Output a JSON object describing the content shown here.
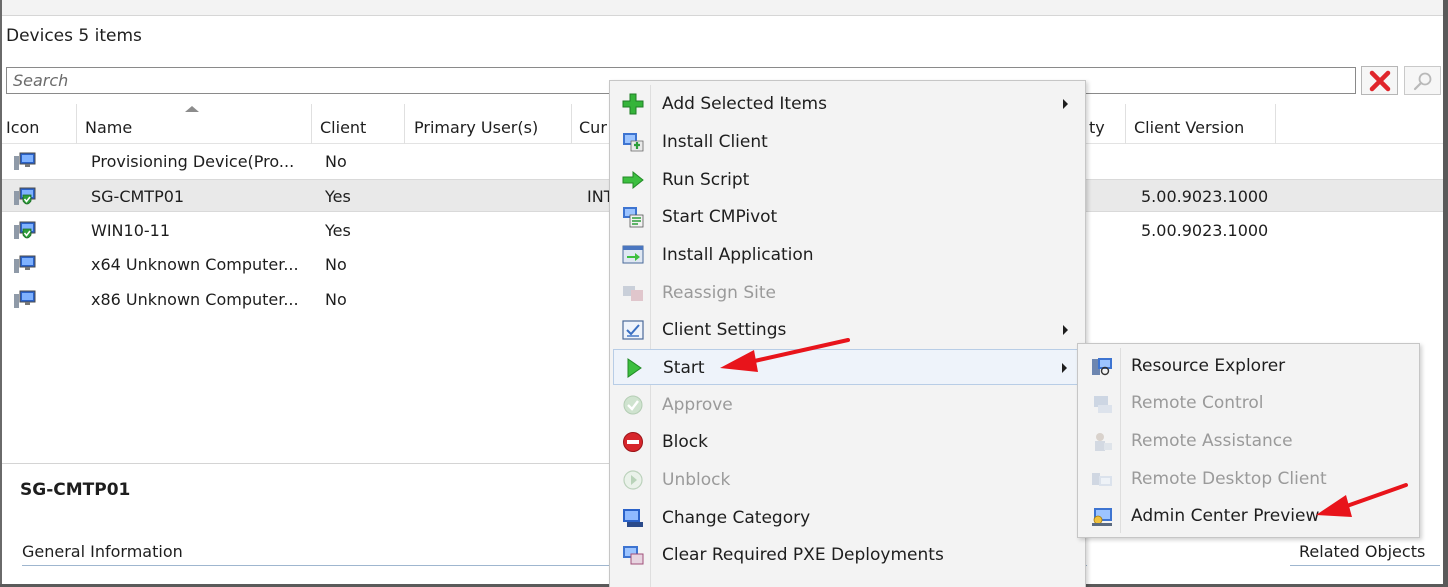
{
  "header": {
    "title": "Devices",
    "count": "5 items"
  },
  "search": {
    "placeholder": "Search"
  },
  "columns": [
    "Icon",
    "Name",
    "Client",
    "Primary User(s)",
    "Cur",
    "ty",
    "Client Version"
  ],
  "rows": [
    {
      "name": "Provisioning Device(Pro...",
      "client": "No",
      "currentuser": "",
      "version": "",
      "status": "plain"
    },
    {
      "name": "SG-CMTP01",
      "client": "Yes",
      "currentuser": "INT",
      "version": "5.00.9023.1000",
      "status": "managed",
      "selected": true
    },
    {
      "name": "WIN10-11",
      "client": "Yes",
      "currentuser": "",
      "version": "5.00.9023.1000",
      "status": "managed"
    },
    {
      "name": "x64 Unknown Computer...",
      "client": "No",
      "currentuser": "",
      "version": "",
      "status": "plain"
    },
    {
      "name": "x86 Unknown Computer...",
      "client": "No",
      "currentuser": "",
      "version": "",
      "status": "plain"
    }
  ],
  "details": {
    "selected_name": "SG-CMTP01",
    "general_info": "General Information",
    "related_objects": "Related Objects"
  },
  "context_menu": {
    "items": [
      {
        "label": "Add Selected Items",
        "icon": "add-icon",
        "submenu": true,
        "disabled": false
      },
      {
        "label": "Install Client",
        "icon": "install-client-icon",
        "submenu": false,
        "disabled": false
      },
      {
        "label": "Run Script",
        "icon": "run-script-icon",
        "submenu": false,
        "disabled": false
      },
      {
        "label": "Start CMPivot",
        "icon": "cmpivot-icon",
        "submenu": false,
        "disabled": false
      },
      {
        "label": "Install Application",
        "icon": "install-application-icon",
        "submenu": false,
        "disabled": false
      },
      {
        "label": "Reassign Site",
        "icon": "reassign-site-icon",
        "submenu": false,
        "disabled": true
      },
      {
        "label": "Client Settings",
        "icon": "client-settings-icon",
        "submenu": true,
        "disabled": false
      },
      {
        "label": "Start",
        "icon": "start-icon",
        "submenu": true,
        "disabled": false,
        "active": true
      },
      {
        "label": "Approve",
        "icon": "approve-icon",
        "submenu": false,
        "disabled": true
      },
      {
        "label": "Block",
        "icon": "block-icon",
        "submenu": false,
        "disabled": false
      },
      {
        "label": "Unblock",
        "icon": "unblock-icon",
        "submenu": false,
        "disabled": true
      },
      {
        "label": "Change Category",
        "icon": "change-category-icon",
        "submenu": false,
        "disabled": false
      },
      {
        "label": "Clear Required PXE Deployments",
        "icon": "clear-pxe-icon",
        "submenu": false,
        "disabled": false
      }
    ]
  },
  "start_submenu": {
    "items": [
      {
        "label": "Resource Explorer",
        "icon": "resource-explorer-icon",
        "disabled": false
      },
      {
        "label": "Remote Control",
        "icon": "remote-control-icon",
        "disabled": true
      },
      {
        "label": "Remote Assistance",
        "icon": "remote-assistance-icon",
        "disabled": true
      },
      {
        "label": "Remote Desktop Client",
        "icon": "remote-desktop-icon",
        "disabled": true
      },
      {
        "label": "Admin Center Preview",
        "icon": "admin-center-icon",
        "disabled": false
      }
    ]
  },
  "colors": {
    "accent_red": "#e8141b",
    "selection_bg": "#e9e9e9",
    "menu_bg": "#f3f3f3",
    "active_border": "#b8cde6"
  }
}
